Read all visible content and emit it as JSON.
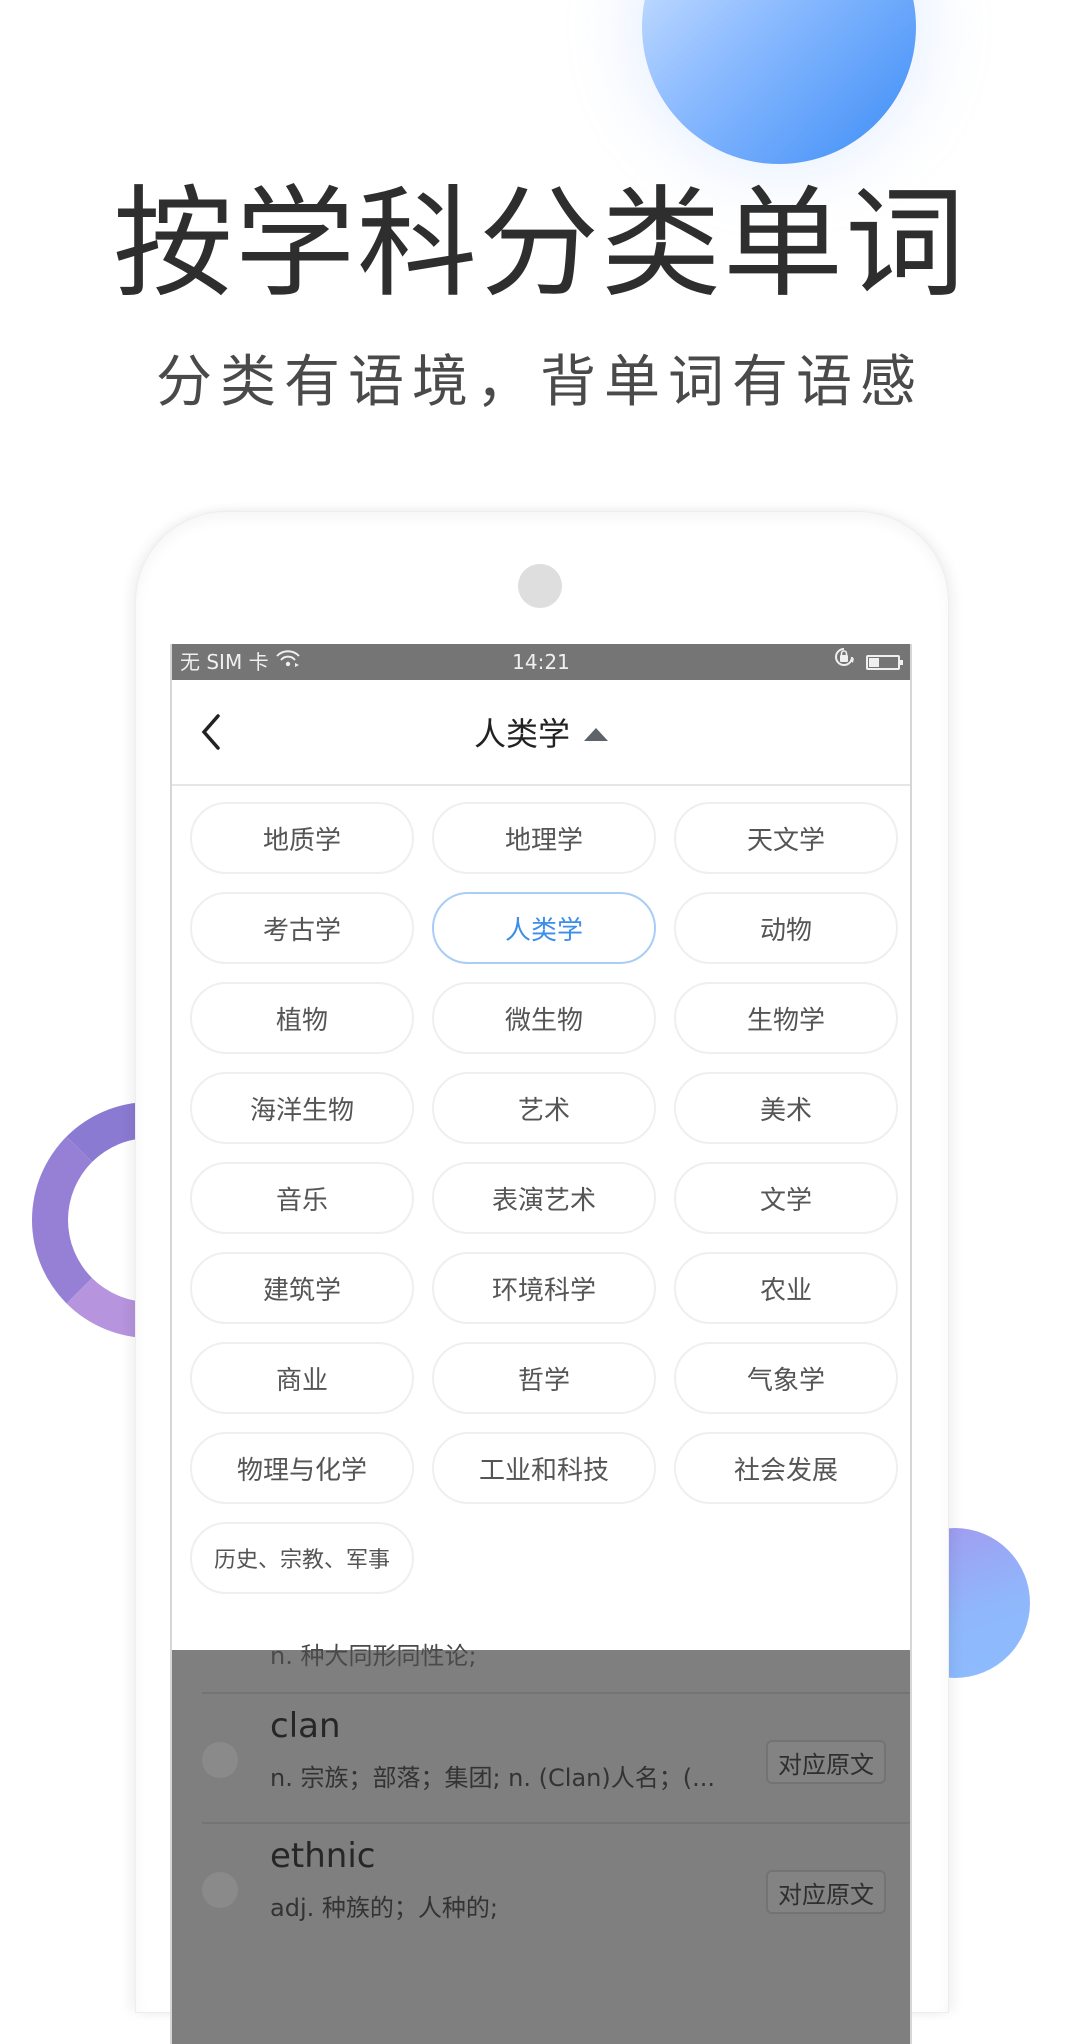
{
  "promo": {
    "headline": "按学科分类单词",
    "subline": "分类有语境，背单词有语感"
  },
  "status_bar": {
    "carrier": "无 SIM 卡",
    "time": "14:21",
    "icons": [
      "wifi-icon",
      "rotation-lock-icon",
      "battery-icon"
    ]
  },
  "nav": {
    "back_icon": "chevron-left-icon",
    "title": "人类学",
    "title_icon": "caret-up-icon"
  },
  "categories": {
    "selected": "人类学",
    "items": [
      "地质学",
      "地理学",
      "天文学",
      "考古学",
      "人类学",
      "动物",
      "植物",
      "微生物",
      "生物学",
      "海洋生物",
      "艺术",
      "美术",
      "音乐",
      "表演艺术",
      "文学",
      "建筑学",
      "环境科学",
      "农业",
      "商业",
      "哲学",
      "气象学",
      "物理与化学",
      "工业和科技",
      "社会发展",
      "历史、宗教、军事"
    ]
  },
  "word_list": {
    "partial_definition": "n. 种大同形同性论;",
    "source_button_label": "对应原文",
    "items": [
      {
        "word": "clan",
        "definition": "n. 宗族；部落；集团; n. (Clan)人名；(..."
      },
      {
        "word": "ethnic",
        "definition": "adj. 种族的；人种的;"
      }
    ]
  },
  "colors": {
    "accent": "#3c8ee8",
    "selected_border": "#a9cdf5",
    "status_bar": "#757575",
    "overlay": "#7f7f7f"
  }
}
